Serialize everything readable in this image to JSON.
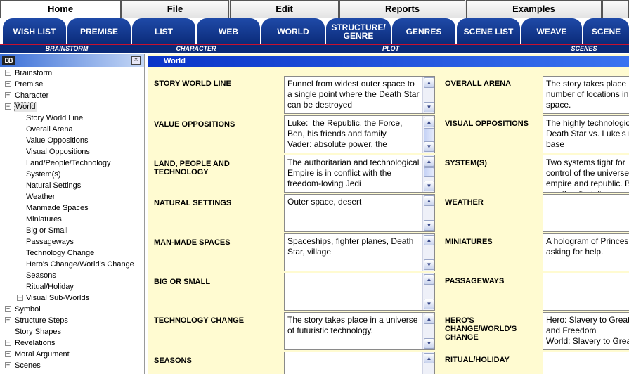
{
  "menu": {
    "tabs": [
      {
        "label": "Home",
        "active": true
      },
      {
        "label": "File"
      },
      {
        "label": "Edit"
      },
      {
        "label": "Reports"
      },
      {
        "label": "Examples"
      }
    ]
  },
  "toolbar": {
    "buttons": [
      "WISH LIST",
      "PREMISE",
      "LIST",
      "WEB",
      "WORLD",
      "STRUCTURE/ GENRE",
      "GENRES",
      "SCENE LIST",
      "WEAVE",
      "SCENE"
    ],
    "groups": [
      "BRAINSTORM",
      "CHARACTER",
      "PLOT",
      "SCENES"
    ]
  },
  "tree": {
    "logo": "BB",
    "close": "×",
    "items": [
      {
        "label": "Brainstorm",
        "expander": "+"
      },
      {
        "label": "Premise",
        "expander": "+"
      },
      {
        "label": "Character",
        "expander": "+"
      },
      {
        "label": "World",
        "expander": "−",
        "selected": true
      },
      {
        "label": "Story World Line"
      },
      {
        "label": "Overall Arena"
      },
      {
        "label": "Value Oppositions"
      },
      {
        "label": "Visual Oppositions"
      },
      {
        "label": "Land/People/Technology"
      },
      {
        "label": "System(s)"
      },
      {
        "label": "Natural Settings"
      },
      {
        "label": "Weather"
      },
      {
        "label": "Manmade Spaces"
      },
      {
        "label": "Miniatures"
      },
      {
        "label": "Big or Small"
      },
      {
        "label": "Passageways"
      },
      {
        "label": "Technology Change"
      },
      {
        "label": "Hero's Change/World's Change"
      },
      {
        "label": "Seasons"
      },
      {
        "label": "Ritual/Holiday"
      },
      {
        "label": "Visual Sub-Worlds",
        "expander": "+"
      },
      {
        "label": "Symbol",
        "expander": "+"
      },
      {
        "label": "Structure Steps",
        "expander": "+"
      },
      {
        "label": "Story Shapes"
      },
      {
        "label": "Revelations",
        "expander": "+"
      },
      {
        "label": "Moral Argument",
        "expander": "+"
      },
      {
        "label": "Scenes",
        "expander": "+"
      }
    ]
  },
  "main": {
    "header": "World",
    "left_fields": [
      {
        "label": "STORY WORLD LINE",
        "value": "Funnel from widest outer space to a single point where the Death Star can be destroyed"
      },
      {
        "label": "VALUE OPPOSITIONS",
        "value": "Luke:  the Republic, the Force, Ben, his friends and family\nVader: absolute power, the"
      },
      {
        "label": "LAND, PEOPLE AND TECHNOLOGY",
        "value": "The authoritarian and technological Empire is in conflict with the freedom-loving Jedi"
      },
      {
        "label": "NATURAL SETTINGS",
        "value": "Outer space, desert"
      },
      {
        "label": "MAN-MADE SPACES",
        "value": "Spaceships, fighter planes, Death Star, village"
      },
      {
        "label": "BIG OR SMALL",
        "value": ""
      },
      {
        "label": "TECHNOLOGY  CHANGE",
        "value": "The story takes place in a universe of futuristic technology."
      },
      {
        "label": "SEASONS",
        "value": ""
      }
    ],
    "right_fields": [
      {
        "label": "OVERALL ARENA",
        "value": "The story takes place in a number of locations in outer space."
      },
      {
        "label": "VISUAL OPPOSITIONS",
        "value": "The highly technological Death Star vs. Luke's rebel base"
      },
      {
        "label": "SYSTEM(S)",
        "value": "Two systems fight for control of the universe: empire and republic. Both use the discipline"
      },
      {
        "label": "WEATHER",
        "value": ""
      },
      {
        "label": "MINIATURES",
        "value": "A hologram of Princess Leia asking for help."
      },
      {
        "label": "PASSAGEWAYS",
        "value": ""
      },
      {
        "label": "HERO'S CHANGE/WORLD'S CHANGE",
        "value": "Hero: Slavery to Greatness and Freedom\nWorld: Slavery to Greatness"
      },
      {
        "label": "RITUAL/HOLIDAY",
        "value": ""
      }
    ]
  },
  "icons": {
    "scroll_up": "scroll-up-arrow-icon",
    "scroll_down": "scroll-down-arrow-icon",
    "close": "close-icon"
  },
  "colors": {
    "toolbar_blue": "#0a2a78",
    "accent_red": "#c8102e",
    "form_background": "#fffbd1",
    "header_blue": "#0a34c8"
  }
}
